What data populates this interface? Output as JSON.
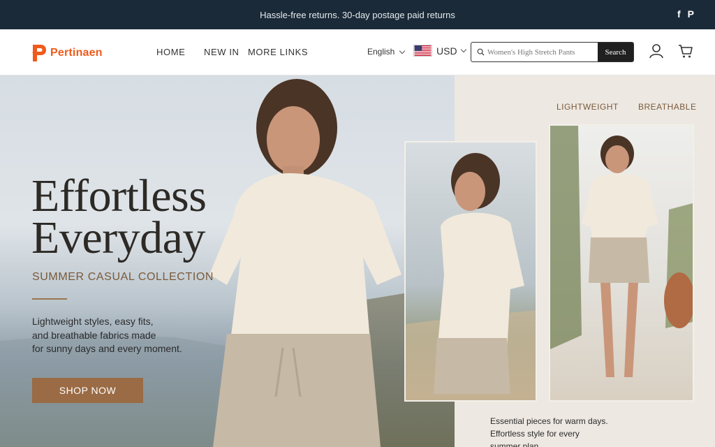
{
  "announcement": {
    "text": "Hassle-free returns. 30-day postage paid returns",
    "social": [
      "f",
      "P"
    ]
  },
  "header": {
    "logo": "Pertinaen",
    "nav": [
      "HOME",
      "NEW IN",
      "MORE LINKS"
    ],
    "language": "English",
    "currency": "USD",
    "search": {
      "placeholder": "Women's High Stretch Pants",
      "button": "Search"
    }
  },
  "hero": {
    "headline_1": "Effortless",
    "headline_2": "Everyday",
    "subheading": "SUMMER CASUAL COLLECTION",
    "description_1": "Lightweight styles, easy fits,",
    "description_2": "and breathable fabrics made",
    "description_3": "for sunny days and every moment.",
    "cta": "SHOP NOW",
    "tags": [
      "LIGHTWEIGHT",
      "BREATHABLE"
    ],
    "caption_1": "Essential pieces for warm days.",
    "caption_2": "Effortless style for every",
    "caption_3": "summer plan."
  },
  "colors": {
    "topbar": "#1b2a38",
    "brand": "#f05a1a",
    "accent": "#9a6b44",
    "panel": "#ede8e2"
  }
}
